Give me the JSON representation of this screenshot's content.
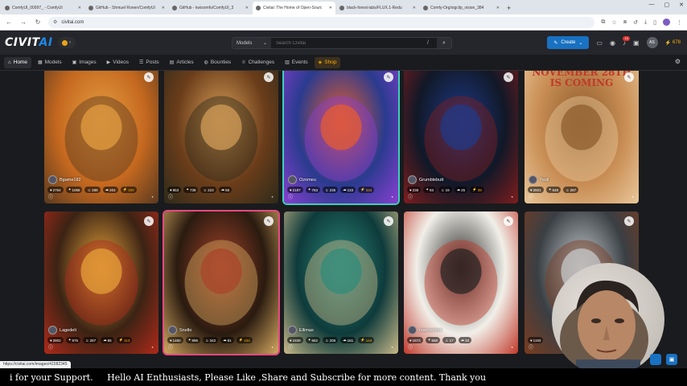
{
  "browser": {
    "tabs": [
      {
        "label": "ComfyUI_00997_ - ComfyUI",
        "active": false
      },
      {
        "label": "GitHub - Shmuel Ronen/ComfyUI",
        "active": false
      },
      {
        "label": "GitHub - kwisomfo/ComfyUI_3",
        "active": false
      },
      {
        "label": "Civitai: The Home of Open-Sourc",
        "active": true
      },
      {
        "label": "black-forest-labs/FLUX.1-Redu",
        "active": false
      },
      {
        "label": "Comfy-Org/sigclip_vision_384",
        "active": false
      }
    ],
    "new_tab": "+",
    "url": "civitai.com"
  },
  "site": {
    "logo_main": "CIVIT",
    "logo_ai": "AI",
    "search": {
      "category": "Models",
      "placeholder": "Search Civitai",
      "shortcut": "/"
    },
    "create_label": "Create",
    "notifications_count": "10",
    "user_initials": "AS",
    "buzz_amount": "678"
  },
  "nav": {
    "items": [
      {
        "label": "Home",
        "icon": "home-icon",
        "glyph": "⌂",
        "active": true
      },
      {
        "label": "Models",
        "icon": "models-icon",
        "glyph": "▦"
      },
      {
        "label": "Images",
        "icon": "images-icon",
        "glyph": "▣"
      },
      {
        "label": "Videos",
        "icon": "videos-icon",
        "glyph": "▶"
      },
      {
        "label": "Posts",
        "icon": "posts-icon",
        "glyph": "☰"
      },
      {
        "label": "Articles",
        "icon": "articles-icon",
        "glyph": "▤"
      },
      {
        "label": "Bounties",
        "icon": "bounties-icon",
        "glyph": "◍"
      },
      {
        "label": "Challenges",
        "icon": "challenges-icon",
        "glyph": "♕"
      },
      {
        "label": "Events",
        "icon": "events-icon",
        "glyph": "▥"
      },
      {
        "label": "Shop",
        "icon": "shop-icon",
        "glyph": "◈"
      }
    ]
  },
  "cards": [
    {
      "author": "Bgame182",
      "stats": [
        "2764",
        "1068",
        "288",
        "204",
        "400"
      ],
      "theme": "autumn-tree",
      "colors": [
        "#c4681f",
        "#e8a042",
        "#5a3a1f"
      ]
    },
    {
      "author": "",
      "stats": [
        "853",
        "738",
        "223",
        "56"
      ],
      "theme": "pie-feast",
      "colors": [
        "#6b3d1a",
        "#d9a15a",
        "#2e2a1a"
      ]
    },
    {
      "author": "Ozomeu",
      "stats": [
        "2187",
        "763",
        "235",
        "133",
        "344"
      ],
      "theme": "fire-lion",
      "colors": [
        "#2a3b8f",
        "#e85d2c",
        "#8a3fd1"
      ],
      "highlight": "teal"
    },
    {
      "author": "Grumblebutt",
      "stats": [
        "238",
        "93",
        "19",
        "25",
        "39"
      ],
      "theme": "dark-forest-path",
      "colors": [
        "#111827",
        "#1e3a8a",
        "#7f1d1d"
      ]
    },
    {
      "author": "Teuli",
      "stats": [
        "2601",
        "648",
        "287"
      ],
      "theme": "turkey-cowboy",
      "colors": [
        "#c98e55",
        "#8b5a2b",
        "#e9c79a"
      ],
      "title": "NOVEMBER 28TH IS COMING"
    },
    {
      "author": "Lagedeli",
      "stats": [
        "2802",
        "975",
        "287",
        "85",
        "113"
      ],
      "theme": "apple-tart",
      "colors": [
        "#3b2314",
        "#e8a53a",
        "#b02a1a"
      ]
    },
    {
      "author": "Snello",
      "stats": [
        "1460",
        "996",
        "342",
        "81",
        "434"
      ],
      "theme": "witch-portrait",
      "colors": [
        "#2a1b10",
        "#a8432a",
        "#d4a860"
      ],
      "highlight": "pink"
    },
    {
      "author": "Ellimas",
      "stats": [
        "1939",
        "662",
        "206",
        "161",
        "144"
      ],
      "theme": "sea-elder",
      "colors": [
        "#0e3b3b",
        "#2d8a7a",
        "#c9b98a"
      ]
    },
    {
      "author": "macoronimi",
      "stats": [
        "1673",
        "568",
        "17",
        "33"
      ],
      "theme": "ink-portrait",
      "colors": [
        "#f1efe8",
        "#222222",
        "#c0392b"
      ]
    },
    {
      "author": "",
      "stats": [
        "1193"
      ],
      "theme": "hockey-mask",
      "colors": [
        "#3a3f44",
        "#c9ced3",
        "#7a3b1f"
      ]
    }
  ],
  "status_url": "https://civitai.com/images/41582345",
  "subtitle": "i for your Support.     Hello AI Enthusiasts, Please Like ,Share and Subscribe for more content. Thank you"
}
